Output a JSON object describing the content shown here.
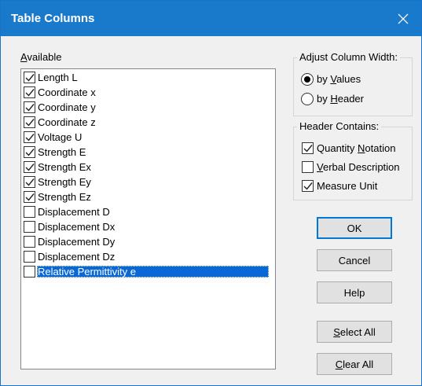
{
  "window": {
    "title": "Table Columns"
  },
  "available": {
    "label": "Available",
    "items": [
      {
        "label": "Length L",
        "checked": true,
        "selected": false
      },
      {
        "label": "Coordinate x",
        "checked": true,
        "selected": false
      },
      {
        "label": "Coordinate y",
        "checked": true,
        "selected": false
      },
      {
        "label": "Coordinate z",
        "checked": true,
        "selected": false
      },
      {
        "label": "Voltage U",
        "checked": true,
        "selected": false
      },
      {
        "label": "Strength E",
        "checked": true,
        "selected": false
      },
      {
        "label": "Strength Ex",
        "checked": true,
        "selected": false
      },
      {
        "label": "Strength Ey",
        "checked": true,
        "selected": false
      },
      {
        "label": "Strength Ez",
        "checked": true,
        "selected": false
      },
      {
        "label": "Displacement D",
        "checked": false,
        "selected": false
      },
      {
        "label": "Displacement Dx",
        "checked": false,
        "selected": false
      },
      {
        "label": "Displacement Dy",
        "checked": false,
        "selected": false
      },
      {
        "label": "Displacement Dz",
        "checked": false,
        "selected": false
      },
      {
        "label": "Relative Permittivity e",
        "checked": false,
        "selected": true
      }
    ]
  },
  "adjust_width": {
    "title": "Adjust Column Width:",
    "options": [
      {
        "label": "by Values",
        "selected": true
      },
      {
        "label": "by Header",
        "selected": false
      }
    ]
  },
  "header_contains": {
    "title": "Header Contains:",
    "options": [
      {
        "label": "Quantity Notation",
        "checked": true
      },
      {
        "label": "Verbal Description",
        "checked": false
      },
      {
        "label": "Measure Unit",
        "checked": true
      }
    ]
  },
  "buttons": {
    "ok": "OK",
    "cancel": "Cancel",
    "help": "Help",
    "select_all": "Select All",
    "clear_all": "Clear All"
  }
}
